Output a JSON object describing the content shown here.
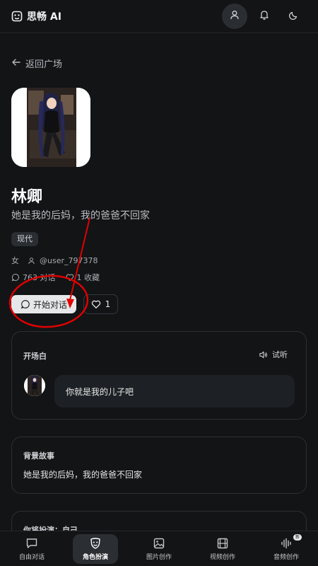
{
  "header": {
    "app_title": "思畅 AI",
    "icons": [
      "user-icon",
      "bell-icon",
      "moon-icon"
    ]
  },
  "back_link": "返回广场",
  "character": {
    "name": "林卿",
    "tagline": "她是我的后妈，我的爸爸不回家",
    "tag": "现代",
    "gender": "女",
    "creator": "@user_797378",
    "chats": "763 对话",
    "favorites": "1 收藏"
  },
  "actions": {
    "start_chat": "开始对话",
    "like_count": "1"
  },
  "opening": {
    "title": "开场白",
    "listen": "试听",
    "message": "你就是我的儿子吧"
  },
  "background": {
    "title": "背景故事",
    "text": "她是我的后妈，我的爸爸不回家"
  },
  "play_as": {
    "title": "你将扮演：自己"
  },
  "nav": {
    "items": [
      {
        "label": "自由对话",
        "icon": "chat-icon"
      },
      {
        "label": "角色扮演",
        "icon": "mask-icon"
      },
      {
        "label": "图片创作",
        "icon": "image-icon"
      },
      {
        "label": "视频创作",
        "icon": "film-icon"
      },
      {
        "label": "音频创作",
        "icon": "audio-icon",
        "badge": "新"
      }
    ]
  },
  "colors": {
    "background": "#121416",
    "annotation": "#e00000"
  }
}
